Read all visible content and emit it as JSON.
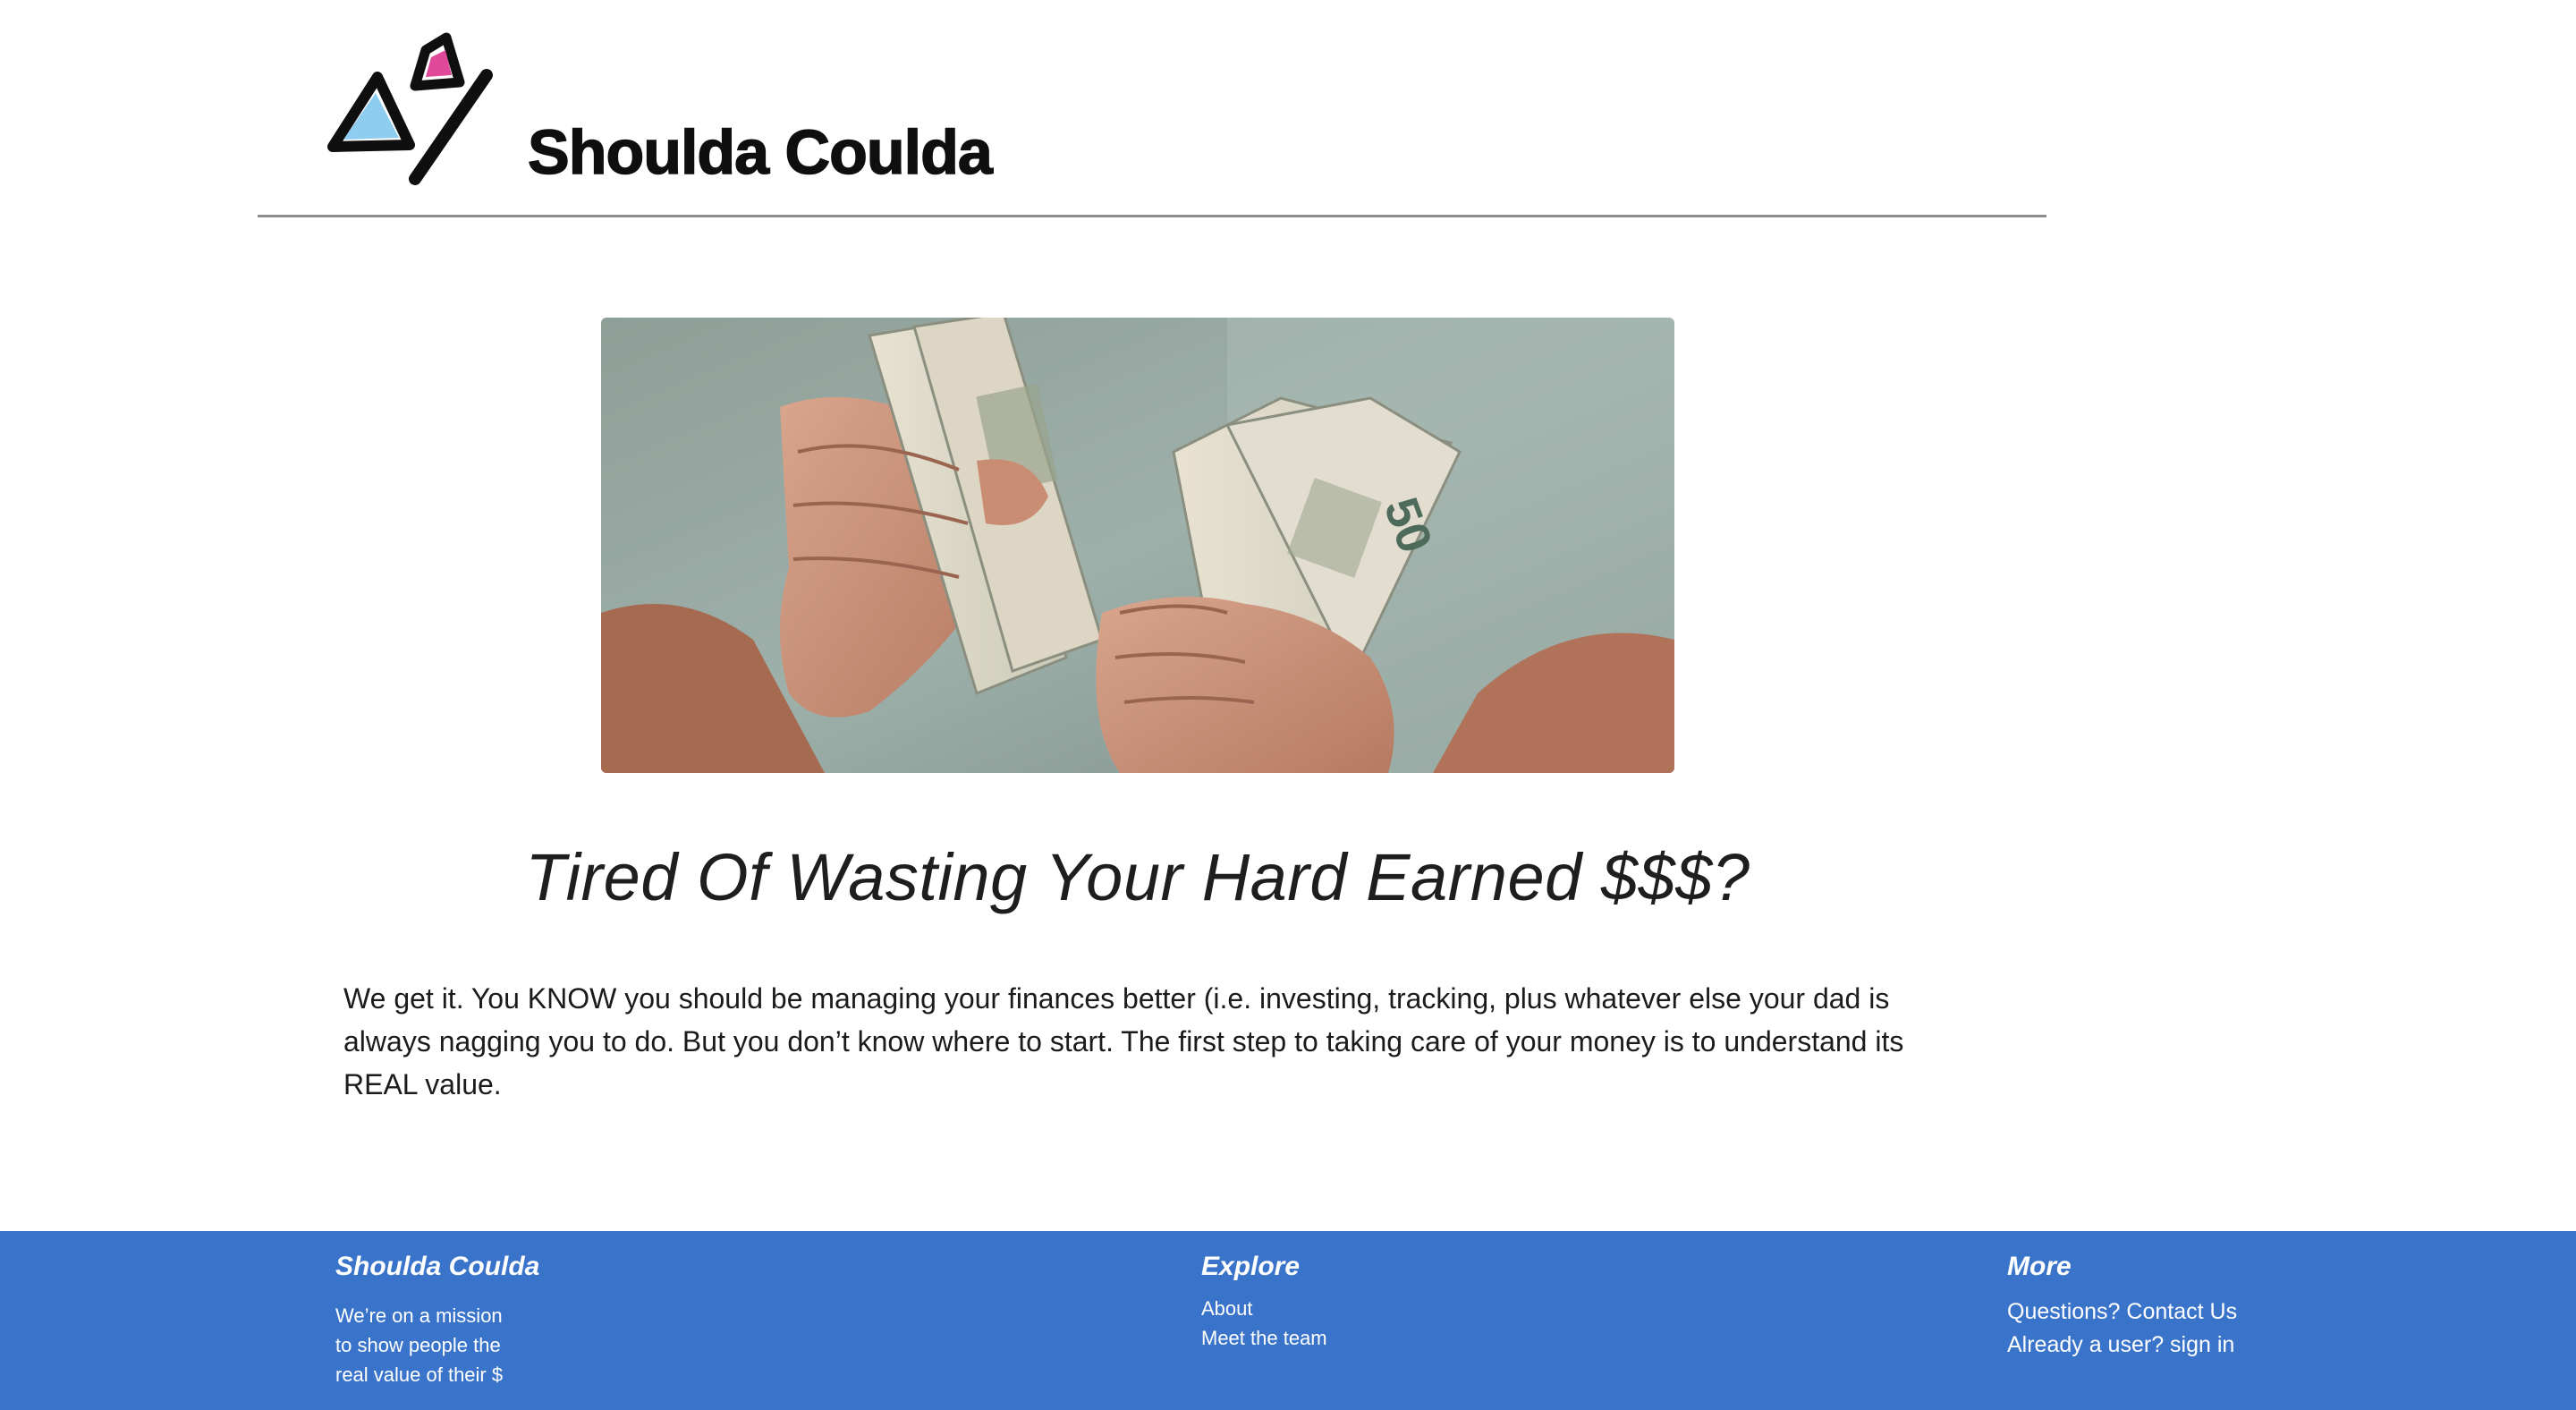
{
  "header": {
    "logo_text": "Shoulda Coulda",
    "colors": {
      "triangle_small": "#e0489a",
      "triangle_large": "#8ecdf0",
      "outline": "#0f0f0f"
    }
  },
  "hero": {
    "image_description_icon": "money-in-hands-photo"
  },
  "main": {
    "headline": "Tired Of Wasting Your Hard Earned $$$?",
    "body": "We get it. You KNOW you should be managing your finances better (i.e. investing, tracking, plus whatever else your dad is always nagging you to do. But you don’t know where to start. The first step to taking care of your money is to understand its REAL value."
  },
  "footer": {
    "background": "#3a74ca",
    "col1": {
      "heading": "Shoulda Coulda",
      "mission_lines": [
        "We’re on a mission",
        "to show people the",
        "real value of their $"
      ]
    },
    "col2": {
      "heading": "Explore",
      "links": [
        "About",
        "Meet the team"
      ]
    },
    "col3": {
      "heading": "More",
      "links": [
        "Questions? Contact Us",
        "Already a user? sign in"
      ]
    }
  }
}
